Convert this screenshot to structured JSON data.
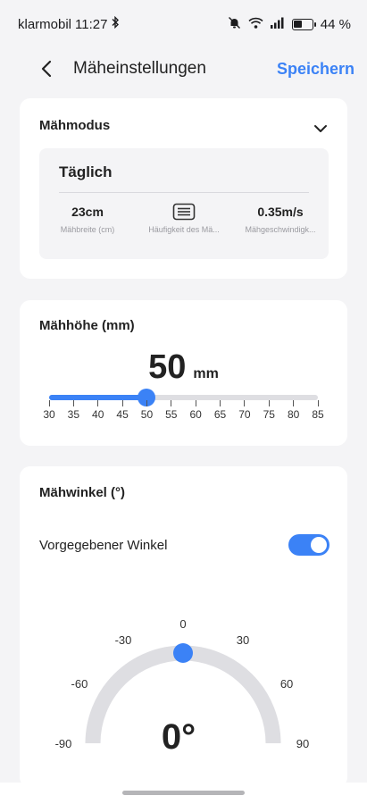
{
  "status_bar": {
    "carrier": "klarmobil",
    "time": "11:27",
    "battery_text": "44 %",
    "battery_level": 0.44
  },
  "header": {
    "title": "Mäheinstellungen",
    "save_label": "Speichern"
  },
  "mow_mode": {
    "title": "Mähmodus",
    "mode_name": "Täglich",
    "stats": [
      {
        "value": "23cm",
        "label": "Mähbreite (cm)"
      },
      {
        "value": "",
        "label": "Häufigkeit des Mä...",
        "icon": "layers-icon"
      },
      {
        "value": "0.35m/s",
        "label": "Mähgeschwindigk..."
      }
    ]
  },
  "mow_height": {
    "title": "Mähhöhe (mm)",
    "value": "50",
    "unit": "mm",
    "min": 30,
    "max": 85,
    "current": 50,
    "ticks": [
      "30",
      "35",
      "40",
      "45",
      "50",
      "55",
      "60",
      "65",
      "70",
      "75",
      "80",
      "85"
    ]
  },
  "mow_angle": {
    "title": "Mähwinkel (°)",
    "toggle_label": "Vorgegebener Winkel",
    "toggle_on": true,
    "value_text": "0°",
    "current": 0,
    "labels": [
      "-90",
      "-60",
      "-30",
      "0",
      "30",
      "60",
      "90"
    ]
  },
  "colors": {
    "accent": "#3b82f6",
    "track": "#dedee2",
    "background": "#f4f4f6"
  }
}
